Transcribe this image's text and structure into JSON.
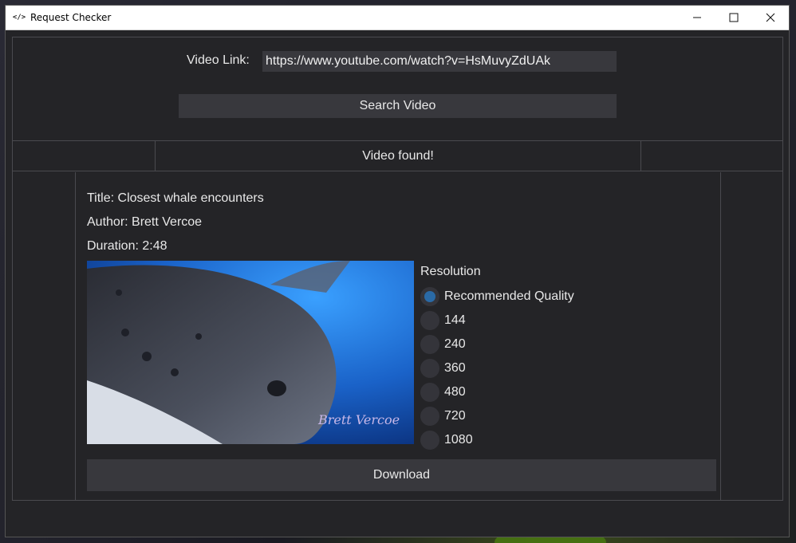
{
  "window": {
    "title": "Request Checker",
    "app_icon": "</>",
    "controls": [
      "minimize-icon",
      "maximize-icon",
      "close-icon"
    ]
  },
  "search": {
    "label": "Video Link:",
    "value": "https://www.youtube.com/watch?v=HsMuvyZdUAk",
    "button_label": "Search Video"
  },
  "status": {
    "message": "Video found!"
  },
  "video": {
    "title_line": "Title: Closest whale encounters",
    "author_line": "Author: Brett Vercoe",
    "duration_line": "Duration: 2:48",
    "thumbnail_watermark": "Brett Vercoe"
  },
  "resolution": {
    "title": "Resolution",
    "selected": "Recommended Quality",
    "options": [
      "Recommended Quality",
      "144",
      "240",
      "360",
      "480",
      "720",
      "1080"
    ]
  },
  "actions": {
    "download_label": "Download"
  },
  "colors": {
    "background": "#242427",
    "control": "#38383d",
    "accent": "#2a6aa6"
  }
}
